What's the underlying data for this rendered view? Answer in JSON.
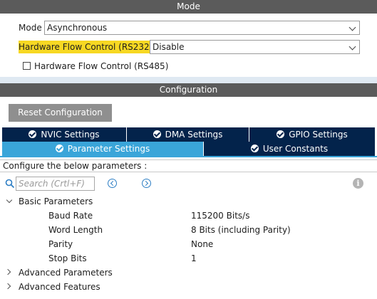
{
  "mode_section": {
    "header": "Mode",
    "mode_label": "Mode",
    "mode_value": "Asynchronous",
    "hw_flow_label": "Hardware Flow Control (RS232)",
    "hw_flow_value": "Disable",
    "rs485_label": "Hardware Flow Control (RS485)",
    "rs485_checked": false
  },
  "config_section": {
    "header": "Configuration",
    "reset_button": "Reset Configuration",
    "tabs_row1": [
      "NVIC Settings",
      "DMA Settings",
      "GPIO Settings"
    ],
    "tabs_row2": [
      "Parameter Settings",
      "User Constants"
    ],
    "active_tab": "Parameter Settings",
    "info_text": "Configure the below parameters :",
    "search_placeholder": "Search (Crtl+F)",
    "info_icon_glyph": "i"
  },
  "tree": {
    "basic": {
      "label": "Basic Parameters",
      "expanded": true,
      "params": [
        {
          "name": "Baud Rate",
          "value": "115200 Bits/s"
        },
        {
          "name": "Word Length",
          "value": "8 Bits (including Parity)"
        },
        {
          "name": "Parity",
          "value": "None"
        },
        {
          "name": "Stop Bits",
          "value": "1"
        }
      ]
    },
    "advanced_params": {
      "label": "Advanced Parameters",
      "expanded": false
    },
    "advanced_features": {
      "label": "Advanced Features",
      "expanded": false
    }
  },
  "colors": {
    "header_bg": "#5b5b5b",
    "tab_dark": "#03234b",
    "tab_active": "#3aa5d9",
    "highlight": "#f7d823",
    "reset_btn": "#8f8f8f"
  }
}
